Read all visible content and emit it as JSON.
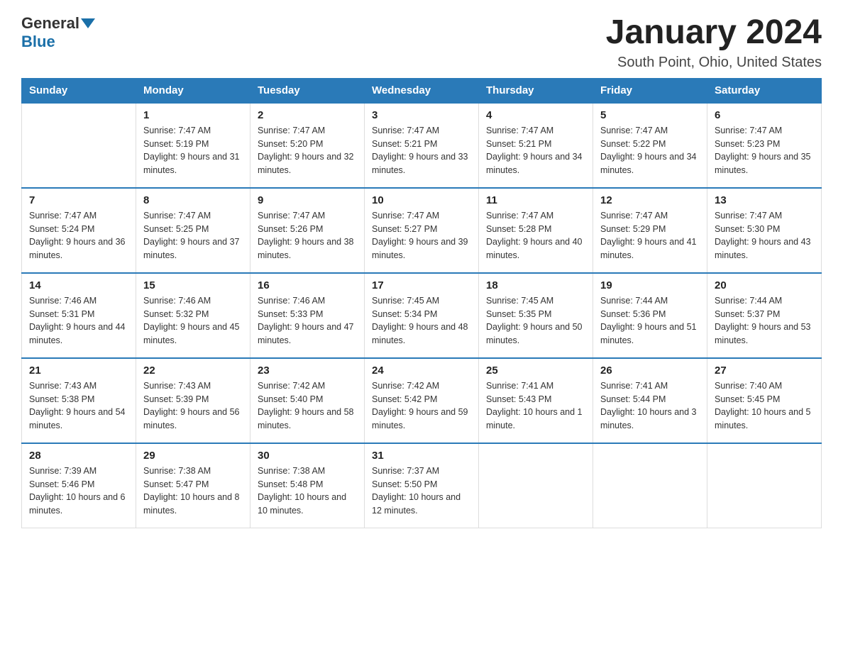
{
  "header": {
    "logo_general": "General",
    "logo_blue": "Blue",
    "title": "January 2024",
    "subtitle": "South Point, Ohio, United States"
  },
  "weekdays": [
    "Sunday",
    "Monday",
    "Tuesday",
    "Wednesday",
    "Thursday",
    "Friday",
    "Saturday"
  ],
  "weeks": [
    [
      {
        "day": "",
        "sunrise": "",
        "sunset": "",
        "daylight": ""
      },
      {
        "day": "1",
        "sunrise": "Sunrise: 7:47 AM",
        "sunset": "Sunset: 5:19 PM",
        "daylight": "Daylight: 9 hours and 31 minutes."
      },
      {
        "day": "2",
        "sunrise": "Sunrise: 7:47 AM",
        "sunset": "Sunset: 5:20 PM",
        "daylight": "Daylight: 9 hours and 32 minutes."
      },
      {
        "day": "3",
        "sunrise": "Sunrise: 7:47 AM",
        "sunset": "Sunset: 5:21 PM",
        "daylight": "Daylight: 9 hours and 33 minutes."
      },
      {
        "day": "4",
        "sunrise": "Sunrise: 7:47 AM",
        "sunset": "Sunset: 5:21 PM",
        "daylight": "Daylight: 9 hours and 34 minutes."
      },
      {
        "day": "5",
        "sunrise": "Sunrise: 7:47 AM",
        "sunset": "Sunset: 5:22 PM",
        "daylight": "Daylight: 9 hours and 34 minutes."
      },
      {
        "day": "6",
        "sunrise": "Sunrise: 7:47 AM",
        "sunset": "Sunset: 5:23 PM",
        "daylight": "Daylight: 9 hours and 35 minutes."
      }
    ],
    [
      {
        "day": "7",
        "sunrise": "Sunrise: 7:47 AM",
        "sunset": "Sunset: 5:24 PM",
        "daylight": "Daylight: 9 hours and 36 minutes."
      },
      {
        "day": "8",
        "sunrise": "Sunrise: 7:47 AM",
        "sunset": "Sunset: 5:25 PM",
        "daylight": "Daylight: 9 hours and 37 minutes."
      },
      {
        "day": "9",
        "sunrise": "Sunrise: 7:47 AM",
        "sunset": "Sunset: 5:26 PM",
        "daylight": "Daylight: 9 hours and 38 minutes."
      },
      {
        "day": "10",
        "sunrise": "Sunrise: 7:47 AM",
        "sunset": "Sunset: 5:27 PM",
        "daylight": "Daylight: 9 hours and 39 minutes."
      },
      {
        "day": "11",
        "sunrise": "Sunrise: 7:47 AM",
        "sunset": "Sunset: 5:28 PM",
        "daylight": "Daylight: 9 hours and 40 minutes."
      },
      {
        "day": "12",
        "sunrise": "Sunrise: 7:47 AM",
        "sunset": "Sunset: 5:29 PM",
        "daylight": "Daylight: 9 hours and 41 minutes."
      },
      {
        "day": "13",
        "sunrise": "Sunrise: 7:47 AM",
        "sunset": "Sunset: 5:30 PM",
        "daylight": "Daylight: 9 hours and 43 minutes."
      }
    ],
    [
      {
        "day": "14",
        "sunrise": "Sunrise: 7:46 AM",
        "sunset": "Sunset: 5:31 PM",
        "daylight": "Daylight: 9 hours and 44 minutes."
      },
      {
        "day": "15",
        "sunrise": "Sunrise: 7:46 AM",
        "sunset": "Sunset: 5:32 PM",
        "daylight": "Daylight: 9 hours and 45 minutes."
      },
      {
        "day": "16",
        "sunrise": "Sunrise: 7:46 AM",
        "sunset": "Sunset: 5:33 PM",
        "daylight": "Daylight: 9 hours and 47 minutes."
      },
      {
        "day": "17",
        "sunrise": "Sunrise: 7:45 AM",
        "sunset": "Sunset: 5:34 PM",
        "daylight": "Daylight: 9 hours and 48 minutes."
      },
      {
        "day": "18",
        "sunrise": "Sunrise: 7:45 AM",
        "sunset": "Sunset: 5:35 PM",
        "daylight": "Daylight: 9 hours and 50 minutes."
      },
      {
        "day": "19",
        "sunrise": "Sunrise: 7:44 AM",
        "sunset": "Sunset: 5:36 PM",
        "daylight": "Daylight: 9 hours and 51 minutes."
      },
      {
        "day": "20",
        "sunrise": "Sunrise: 7:44 AM",
        "sunset": "Sunset: 5:37 PM",
        "daylight": "Daylight: 9 hours and 53 minutes."
      }
    ],
    [
      {
        "day": "21",
        "sunrise": "Sunrise: 7:43 AM",
        "sunset": "Sunset: 5:38 PM",
        "daylight": "Daylight: 9 hours and 54 minutes."
      },
      {
        "day": "22",
        "sunrise": "Sunrise: 7:43 AM",
        "sunset": "Sunset: 5:39 PM",
        "daylight": "Daylight: 9 hours and 56 minutes."
      },
      {
        "day": "23",
        "sunrise": "Sunrise: 7:42 AM",
        "sunset": "Sunset: 5:40 PM",
        "daylight": "Daylight: 9 hours and 58 minutes."
      },
      {
        "day": "24",
        "sunrise": "Sunrise: 7:42 AM",
        "sunset": "Sunset: 5:42 PM",
        "daylight": "Daylight: 9 hours and 59 minutes."
      },
      {
        "day": "25",
        "sunrise": "Sunrise: 7:41 AM",
        "sunset": "Sunset: 5:43 PM",
        "daylight": "Daylight: 10 hours and 1 minute."
      },
      {
        "day": "26",
        "sunrise": "Sunrise: 7:41 AM",
        "sunset": "Sunset: 5:44 PM",
        "daylight": "Daylight: 10 hours and 3 minutes."
      },
      {
        "day": "27",
        "sunrise": "Sunrise: 7:40 AM",
        "sunset": "Sunset: 5:45 PM",
        "daylight": "Daylight: 10 hours and 5 minutes."
      }
    ],
    [
      {
        "day": "28",
        "sunrise": "Sunrise: 7:39 AM",
        "sunset": "Sunset: 5:46 PM",
        "daylight": "Daylight: 10 hours and 6 minutes."
      },
      {
        "day": "29",
        "sunrise": "Sunrise: 7:38 AM",
        "sunset": "Sunset: 5:47 PM",
        "daylight": "Daylight: 10 hours and 8 minutes."
      },
      {
        "day": "30",
        "sunrise": "Sunrise: 7:38 AM",
        "sunset": "Sunset: 5:48 PM",
        "daylight": "Daylight: 10 hours and 10 minutes."
      },
      {
        "day": "31",
        "sunrise": "Sunrise: 7:37 AM",
        "sunset": "Sunset: 5:50 PM",
        "daylight": "Daylight: 10 hours and 12 minutes."
      },
      {
        "day": "",
        "sunrise": "",
        "sunset": "",
        "daylight": ""
      },
      {
        "day": "",
        "sunrise": "",
        "sunset": "",
        "daylight": ""
      },
      {
        "day": "",
        "sunrise": "",
        "sunset": "",
        "daylight": ""
      }
    ]
  ]
}
